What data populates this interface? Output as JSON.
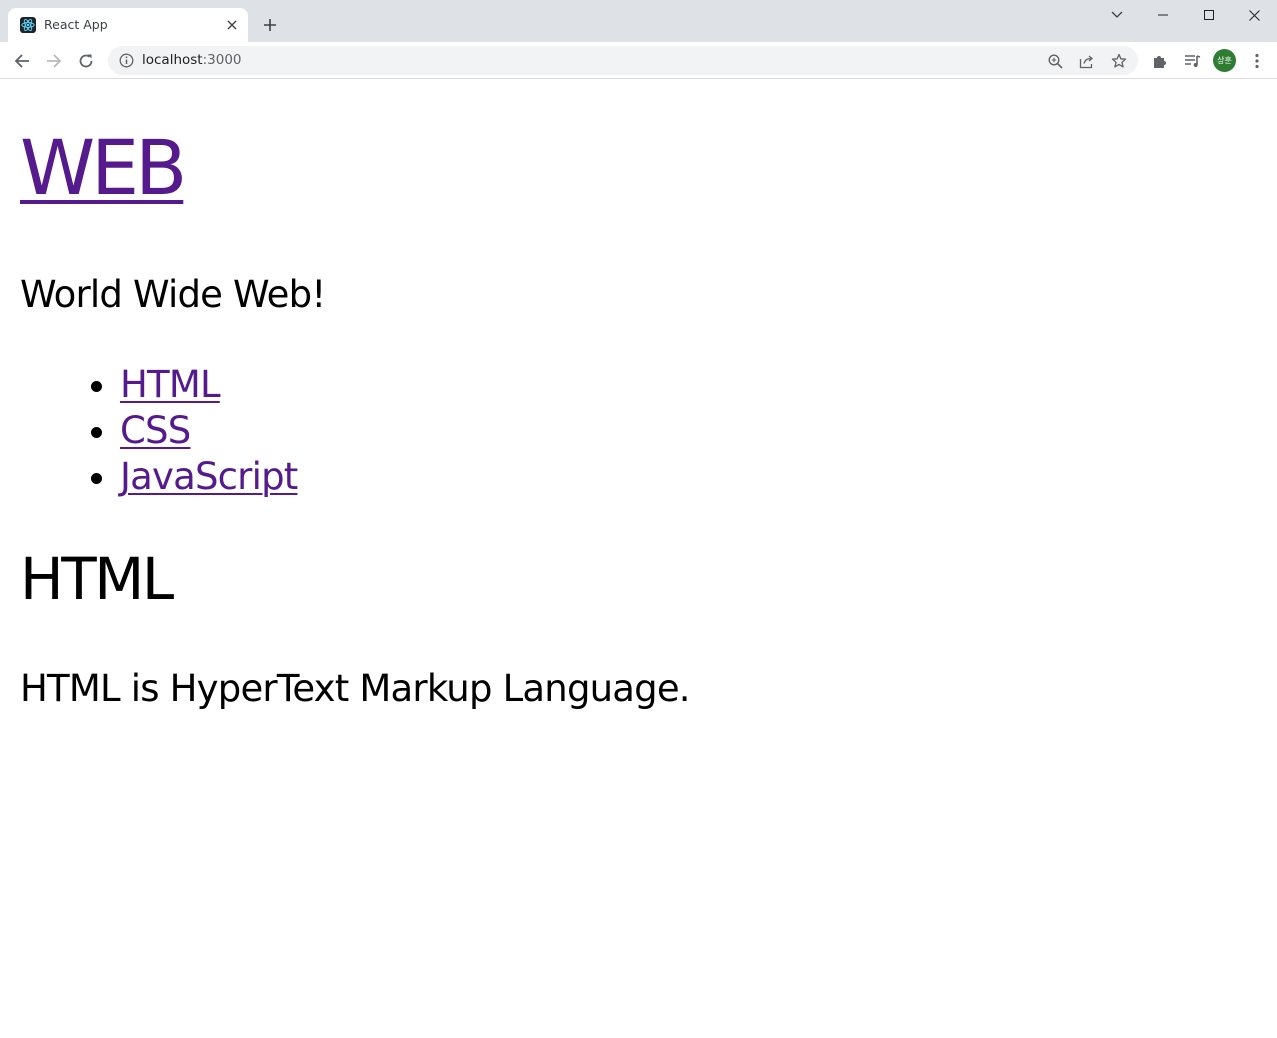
{
  "browser": {
    "tab": {
      "title": "React App",
      "favicon": "react-logo-icon"
    },
    "address_bar": {
      "host": "localhost",
      "port": ":3000"
    },
    "profile_initials": "상훈"
  },
  "page": {
    "site_title": "WEB",
    "intro": "World Wide Web!",
    "nav": [
      {
        "label": "HTML"
      },
      {
        "label": "CSS"
      },
      {
        "label": "JavaScript"
      }
    ],
    "article": {
      "title": "HTML",
      "body": "HTML is HyperText Markup Language."
    }
  },
  "colors": {
    "link_visited": "#551a8b",
    "tabstrip": "#dee1e6",
    "omnibox": "#f1f3f4",
    "avatar": "#2e7d32"
  }
}
